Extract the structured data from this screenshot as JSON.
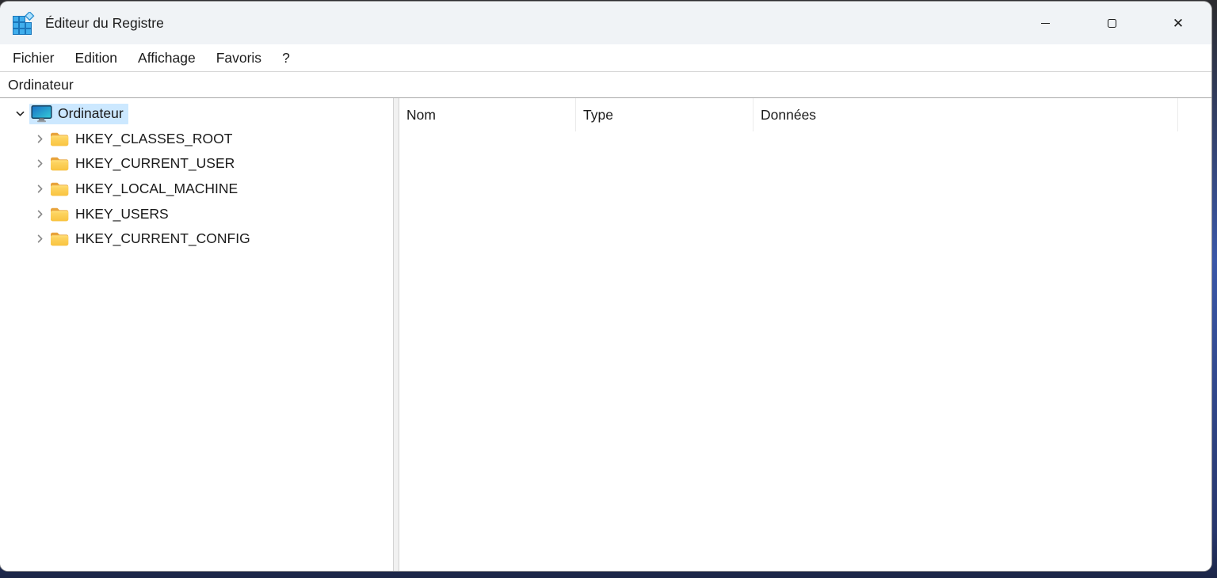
{
  "window": {
    "title": "Éditeur du Registre",
    "app_icon": "registry-editor-icon",
    "controls": {
      "minimize_icon": "minimize-icon",
      "maximize_icon": "maximize-icon",
      "close_icon": "close-icon"
    }
  },
  "menu_bar": {
    "items": [
      "Fichier",
      "Edition",
      "Affichage",
      "Favoris",
      "?"
    ]
  },
  "address_bar": {
    "value": "Ordinateur"
  },
  "tree_panel": {
    "root": {
      "label": "Ordinateur",
      "icon": "computer-icon",
      "expanded": true,
      "selected": true
    },
    "children": [
      {
        "label": "HKEY_CLASSES_ROOT",
        "icon": "folder-icon",
        "expanded": false
      },
      {
        "label": "HKEY_CURRENT_USER",
        "icon": "folder-icon",
        "expanded": false
      },
      {
        "label": "HKEY_LOCAL_MACHINE",
        "icon": "folder-icon",
        "expanded": false
      },
      {
        "label": "HKEY_USERS",
        "icon": "folder-icon",
        "expanded": false
      },
      {
        "label": "HKEY_CURRENT_CONFIG",
        "icon": "folder-icon",
        "expanded": false
      }
    ]
  },
  "list_panel": {
    "columns": [
      {
        "label": "Nom"
      },
      {
        "label": "Type"
      },
      {
        "label": "Données"
      }
    ],
    "rows": []
  },
  "colors": {
    "selection_highlight": "#cce8ff",
    "title_bar_background": "#f0f3f6",
    "folder_icon_amber": "#fbcd55",
    "computer_screen_blue": "#1d6fc4",
    "desktop_edge_blue": "#3a57a8",
    "desktop_edge_navy": "#1f2b52"
  }
}
